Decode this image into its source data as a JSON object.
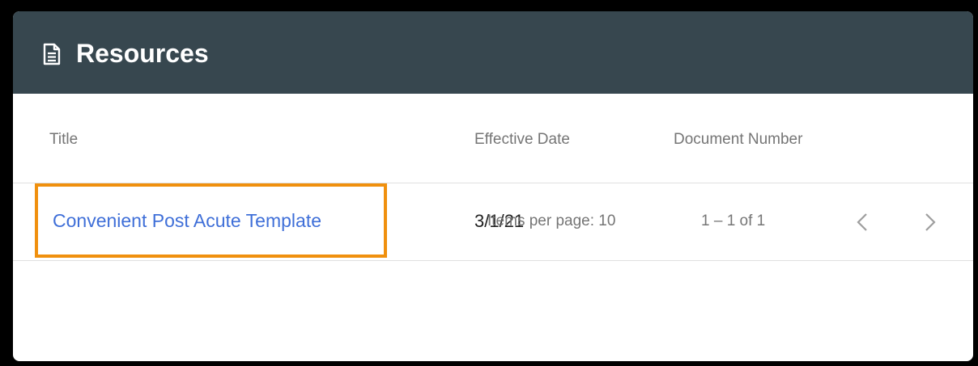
{
  "header": {
    "title": "Resources",
    "icon": "document-icon",
    "background": "#37474f"
  },
  "table": {
    "columns": [
      "Title",
      "Effective Date",
      "Document Number"
    ],
    "rows": [
      {
        "title": "Convenient Post Acute Template",
        "effective_date": "3/1/21",
        "document_number": ""
      }
    ]
  },
  "paginator": {
    "items_per_page_label": "Items per page: 10",
    "range_label": "1 – 1 of 1",
    "prev_icon": "chevron-left-icon",
    "next_icon": "chevron-right-icon"
  },
  "colors": {
    "link": "#3f6fd8",
    "highlight": "#f0900e"
  }
}
